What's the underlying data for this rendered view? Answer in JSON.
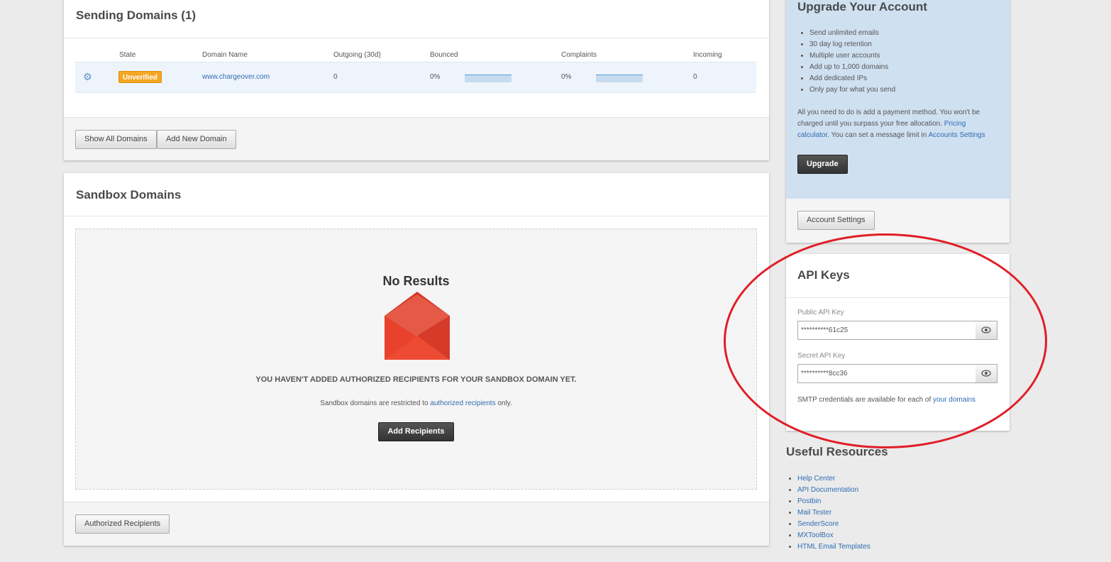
{
  "sending": {
    "title": "Sending Domains (1)",
    "columns": [
      "State",
      "Domain Name",
      "Outgoing (30d)",
      "Bounced",
      "Complaints",
      "Incoming"
    ],
    "row": {
      "state": "Unverified",
      "domain": "www.chargeover.com",
      "outgoing": "0",
      "bounced": "0%",
      "complaints": "0%",
      "incoming": "0"
    },
    "show_all_label": "Show All Domains",
    "add_new_label": "Add New Domain"
  },
  "sandbox": {
    "title": "Sandbox Domains",
    "empty_title": "No Results",
    "empty_heading": "YOU HAVEN'T ADDED AUTHORIZED RECIPIENTS FOR YOUR SANDBOX DOMAIN YET.",
    "empty_text_before": "Sandbox domains are restricted to ",
    "empty_link": "authorized recipients",
    "empty_text_after": " only.",
    "add_recipients_label": "Add Recipients",
    "authorized_label": "Authorized Recipients"
  },
  "upgrade": {
    "title": "Upgrade Your Account",
    "features": [
      "Send unlimited emails",
      "30 day log retention",
      "Multiple user accounts",
      "Add up to 1,000 domains",
      "Add dedicated IPs",
      "Only pay for what you send"
    ],
    "text1": "All you need to do is add a payment method. You won't be charged until you surpass your free allocation. ",
    "pricing_link": "Pricing calculator",
    "text2": ". You can set a message limit in ",
    "settings_link": "Accounts Settings",
    "upgrade_label": "Upgrade",
    "account_settings_label": "Account Settings"
  },
  "api": {
    "title": "API Keys",
    "public_label": "Public API Key",
    "public_value": "**********61c25",
    "secret_label": "Secret API Key",
    "secret_value": "**********8cc36",
    "smtp_text": "SMTP credentials are available for each of ",
    "smtp_link": "your domains"
  },
  "resources": {
    "title": "Useful Resources",
    "links": [
      "Help Center",
      "API Documentation",
      "Postbin",
      "Mail Tester",
      "SenderScore",
      "MXToolBox",
      "HTML Email Templates"
    ]
  },
  "colors": {
    "badge": "#f5a623",
    "link": "#2f6db3",
    "upgrade_bg": "#cfe0f1",
    "annotation": "#e01e27",
    "envelope": "#e8412c"
  },
  "icons": {
    "settings": "gear-icon",
    "reveal": "eye-icon",
    "empty": "envelope-icon"
  }
}
